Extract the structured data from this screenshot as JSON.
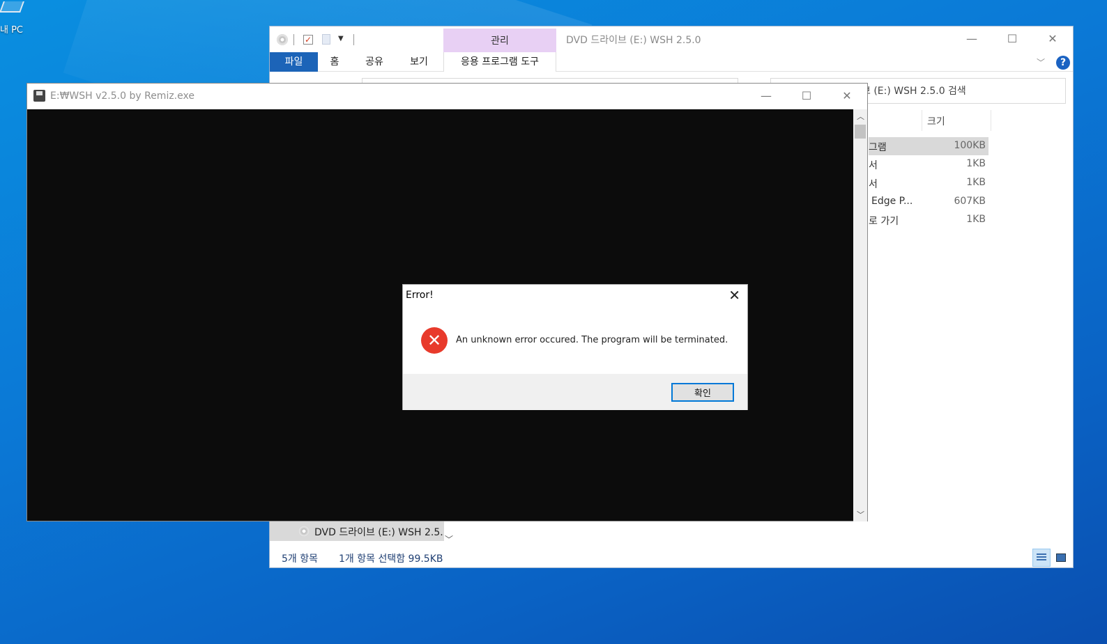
{
  "desktop": {
    "icon_label": "내 PC"
  },
  "explorer": {
    "title": "DVD 드라이브 (E:) WSH 2.5.0",
    "context_tab": "관리",
    "ribbon_tabs": {
      "file": "파일",
      "home": "홈",
      "share": "공유",
      "view": "보기",
      "app_tools": "응용 프로그램 도구"
    },
    "window_buttons": {
      "minimize": "—",
      "maximize": "☐",
      "close": "✕"
    },
    "search_placeholder": "브 (E:) WSH 2.5.0 검색",
    "column_header": "크기",
    "files": [
      {
        "name": "그램",
        "size": "100KB"
      },
      {
        "name": "서",
        "size": "1KB"
      },
      {
        "name": "서",
        "size": "1KB"
      },
      {
        "name": "Edge P...",
        "size": "607KB"
      },
      {
        "name": "로 가기",
        "size": "1KB"
      }
    ],
    "nav_drive": "DVD 드라이브 (E:) WSH 2.5.",
    "status": {
      "item_count": "5개 항목",
      "selection": "1개 항목 선택함 99.5KB"
    }
  },
  "console": {
    "title": "E:₩WSH v2.5.0 by Remiz.exe",
    "window_buttons": {
      "minimize": "—",
      "maximize": "☐",
      "close": "✕"
    }
  },
  "dialog": {
    "title": "Error!",
    "message": "An unknown error occured. The program will be terminated.",
    "ok_label": "확인",
    "close_glyph": "✕",
    "icon_glyph": "✕"
  },
  "colors": {
    "accent": "#1c64b8",
    "context_tab": "#e8d0f4",
    "error_red": "#e83a2b",
    "console_bg": "#0c0c0c"
  }
}
